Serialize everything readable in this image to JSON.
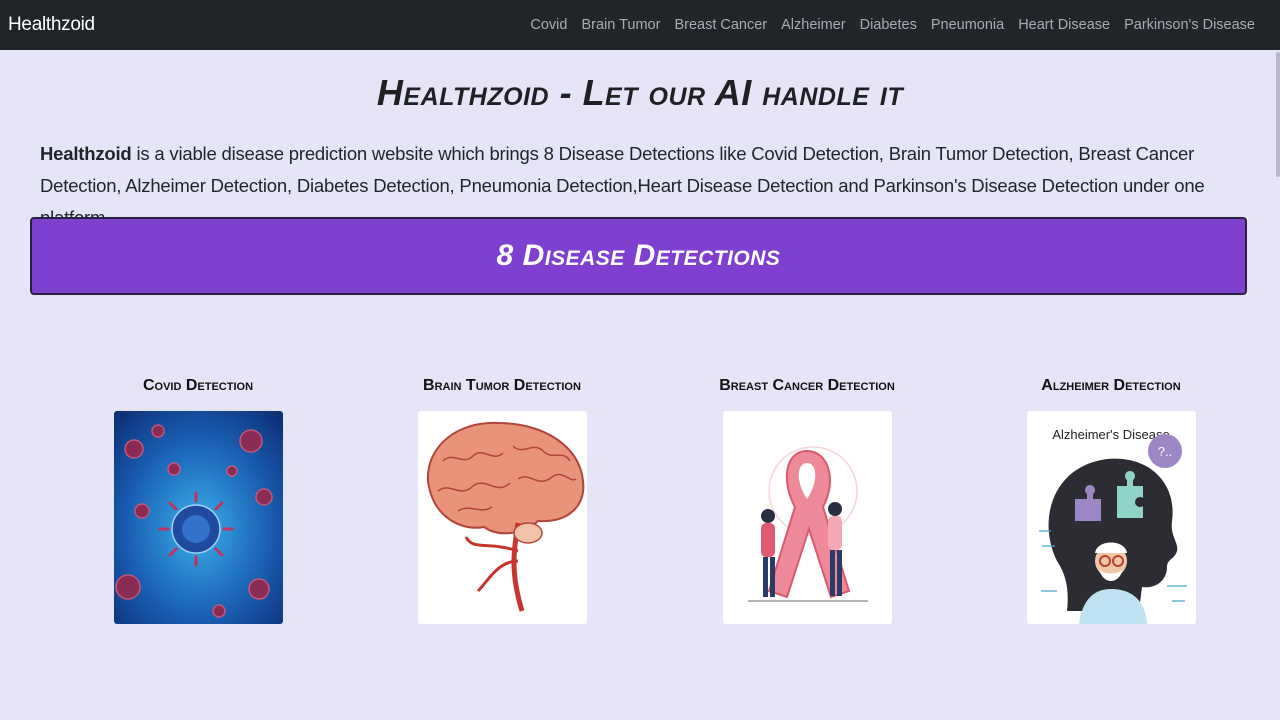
{
  "nav": {
    "brand": "Healthzoid",
    "links": [
      "Covid",
      "Brain Tumor",
      "Breast Cancer",
      "Alzheimer",
      "Diabetes",
      "Pneumonia",
      "Heart Disease",
      "Parkinson's Disease"
    ]
  },
  "hero": {
    "title": "Healthzoid - Let our AI handle it",
    "intro_brand": "Healthzoid",
    "intro_text": " is a viable disease prediction website which brings 8 Disease Detections like Covid Detection, Brain Tumor Detection, Breast Cancer Detection, Alzheimer Detection, Diabetes Detection, Pneumonia Detection,Heart Disease Detection and Parkinson's Disease Detection under one platform."
  },
  "banner": {
    "text": "8 Disease Detections",
    "color": "#7f3fd0"
  },
  "cards": [
    {
      "title": "Covid Detection",
      "image": "covid-virus-illustration"
    },
    {
      "title": "Brain Tumor Detection",
      "image": "brain-illustration"
    },
    {
      "title": "Breast Cancer Detection",
      "image": "pink-ribbon-illustration"
    },
    {
      "title": "Alzheimer Detection",
      "image": "alzheimer-head-illustration",
      "image_caption": "Alzheimer's Disease",
      "bubble_text": "?.."
    }
  ]
}
